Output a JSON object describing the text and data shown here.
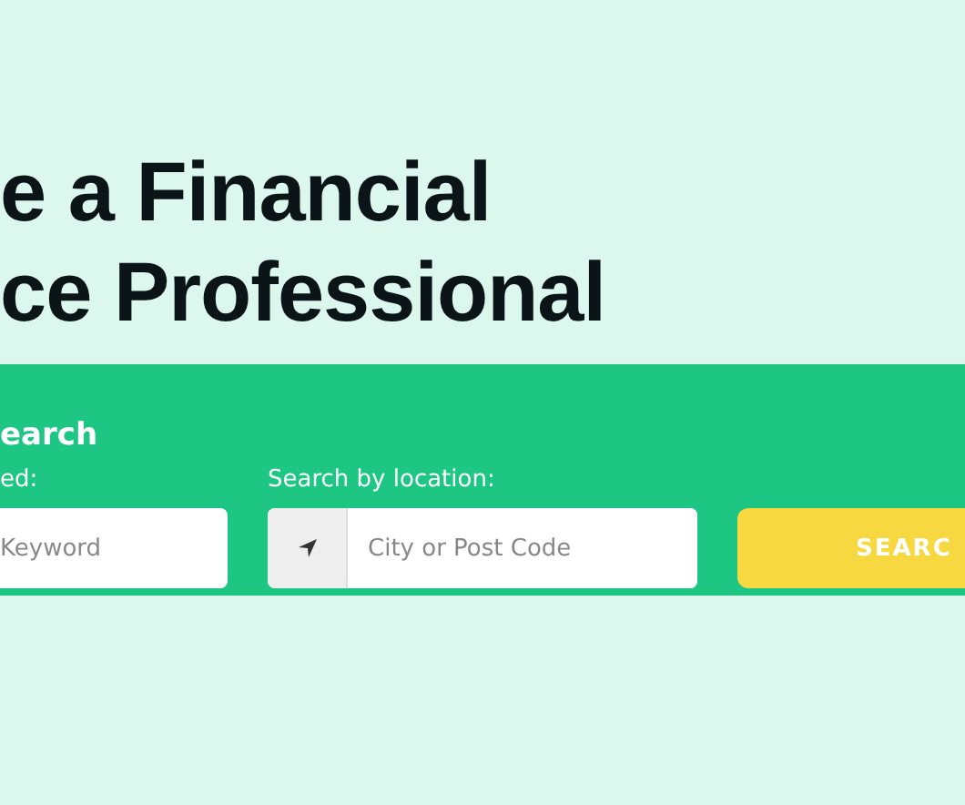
{
  "heading": {
    "lines": [
      "e a Financial",
      "ce Professional"
    ]
  },
  "search_panel": {
    "title": "earch",
    "keyword": {
      "label": "ed:",
      "placeholder": "Keyword"
    },
    "location": {
      "label": "Search by location:",
      "placeholder": "City or Post Code"
    },
    "button": "SEARC"
  }
}
